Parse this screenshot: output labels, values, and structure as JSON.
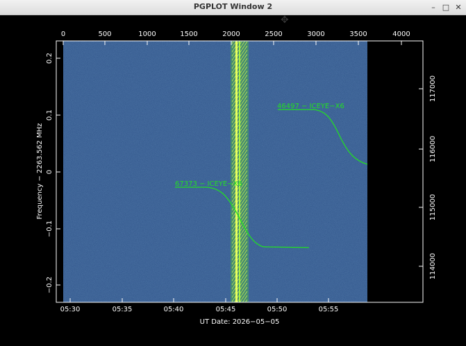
{
  "window": {
    "title": "PGPLOT Window 2"
  },
  "plot": {
    "top_ticks": [
      "0",
      "500",
      "1000",
      "1500",
      "2000",
      "2500",
      "3000",
      "3500",
      "4000"
    ],
    "left_ticks": [
      "0.2",
      "0.1",
      "0",
      "−0.1",
      "−0.2"
    ],
    "right_ticks": [
      "117000",
      "116000",
      "115000",
      "114000"
    ],
    "bottom_ticks": [
      "05:30",
      "05:35",
      "05:40",
      "05:45",
      "05:50",
      "05:55"
    ],
    "ylabel": "Frequency − 2263.562 MHz",
    "xlabel": "UT Date: 2026−05−05",
    "annotations": [
      {
        "text": "46497 − ICEYE−X6"
      },
      {
        "text": "67373 − ICEYE−X6"
      }
    ],
    "colors": {
      "background": "#2c4f86",
      "signal": "#22e022",
      "frame": "#ffffff"
    }
  }
}
